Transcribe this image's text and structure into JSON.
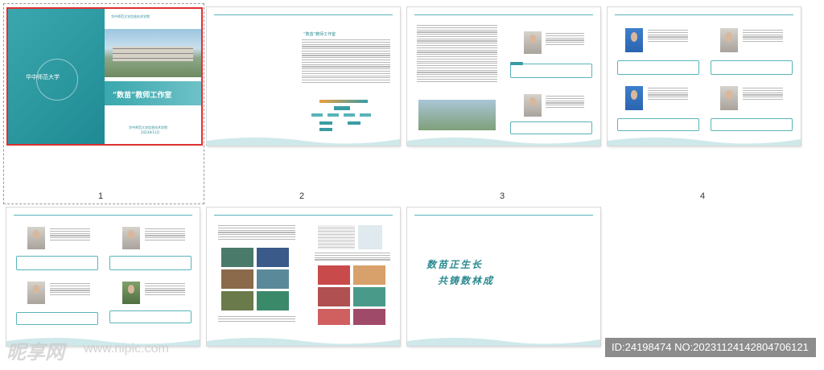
{
  "pages": [
    {
      "number": "1",
      "selected": true
    },
    {
      "number": "2"
    },
    {
      "number": "3"
    },
    {
      "number": "4"
    },
    {
      "number": "",
      "selected": false
    },
    {
      "number": ""
    },
    {
      "number": ""
    }
  ],
  "cover": {
    "school_logo_text": "华中师范大学",
    "header_text": "华中师范大学信息技术学院",
    "title": "“数苗”教师工作室",
    "footer_line1": "华中师范大学信息技术学院",
    "footer_line2": "2023年11月"
  },
  "page2": {
    "title": "“数苗”教师工作室"
  },
  "closing_page": {
    "line1": "数苗正生长",
    "line2": "共铸数林成"
  },
  "watermark": {
    "logo": "昵享网",
    "url": "www.nipic.com",
    "id_text": "ID:24198474 NO:20231124142804706121"
  },
  "colors": {
    "accent": "#3a9ca3",
    "selection": "#e03030"
  }
}
